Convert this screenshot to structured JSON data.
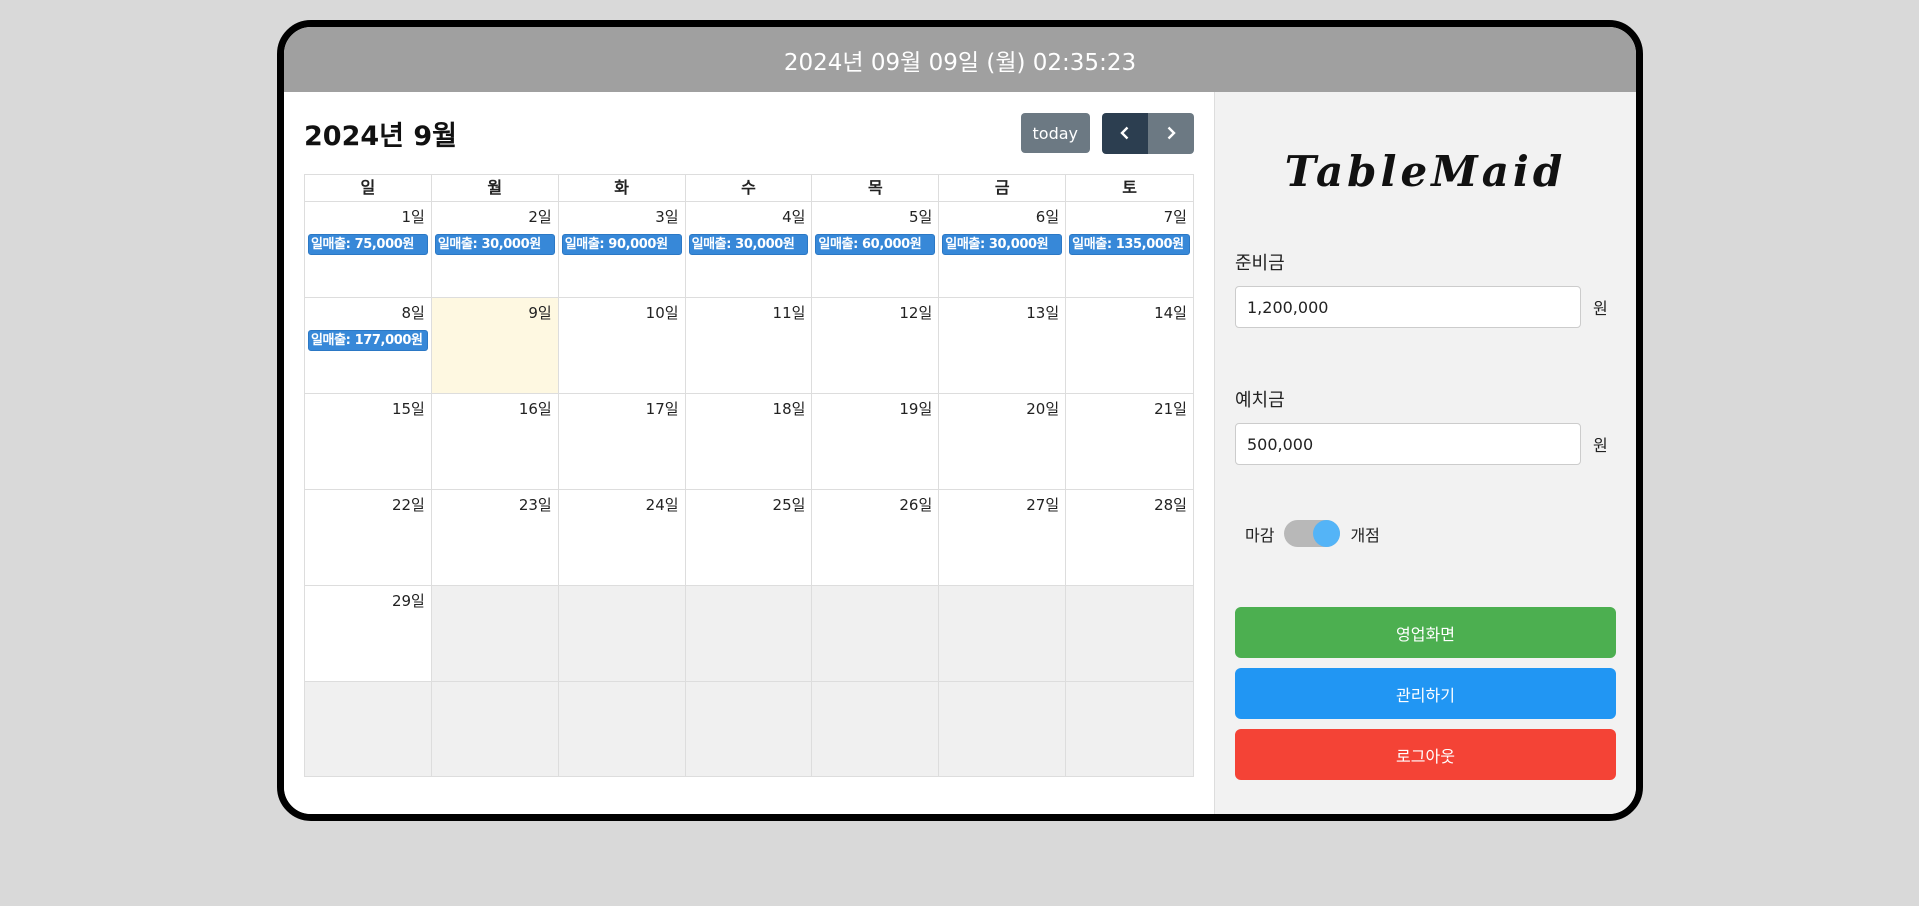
{
  "header": {
    "datetime": "2024년 09월 09일 (월) 02:35:23"
  },
  "calendar": {
    "title": "2024년 9월",
    "today_label": "today",
    "weekdays": [
      "일",
      "월",
      "화",
      "수",
      "목",
      "금",
      "토"
    ],
    "days": {
      "d1": "1일",
      "d2": "2일",
      "d3": "3일",
      "d4": "4일",
      "d5": "5일",
      "d6": "6일",
      "d7": "7일",
      "d8": "8일",
      "d9": "9일",
      "d10": "10일",
      "d11": "11일",
      "d12": "12일",
      "d13": "13일",
      "d14": "14일",
      "d15": "15일",
      "d16": "16일",
      "d17": "17일",
      "d18": "18일",
      "d19": "19일",
      "d20": "20일",
      "d21": "21일",
      "d22": "22일",
      "d23": "23일",
      "d24": "24일",
      "d25": "25일",
      "d26": "26일",
      "d27": "27일",
      "d28": "28일",
      "d29": "29일"
    },
    "events": {
      "d1": "일매출: 75,000원",
      "d2": "일매출: 30,000원",
      "d3": "일매출: 90,000원",
      "d4": "일매출: 30,000원",
      "d5": "일매출: 60,000원",
      "d6": "일매출: 30,000원",
      "d7": "일매출: 135,000원",
      "d8": "일매출: 177,000원"
    }
  },
  "sidebar": {
    "logo": "TableMaid",
    "reserve_label": "준비금",
    "reserve_value": "1,200,000",
    "deposit_label": "예치금",
    "deposit_value": "500,000",
    "unit": "원",
    "toggle_off_label": "마감",
    "toggle_on_label": "개점",
    "toggle_state": "on",
    "btn_sales": "영업화면",
    "btn_manage": "관리하기",
    "btn_logout": "로그아웃"
  },
  "colors": {
    "topbar": "#a0a0a0",
    "event": "#3788d8",
    "today_bg": "#fef8e1",
    "sales": "#4caf50",
    "manage": "#2196f3",
    "logout": "#f44336",
    "toggle_knob": "#54b4f7"
  }
}
